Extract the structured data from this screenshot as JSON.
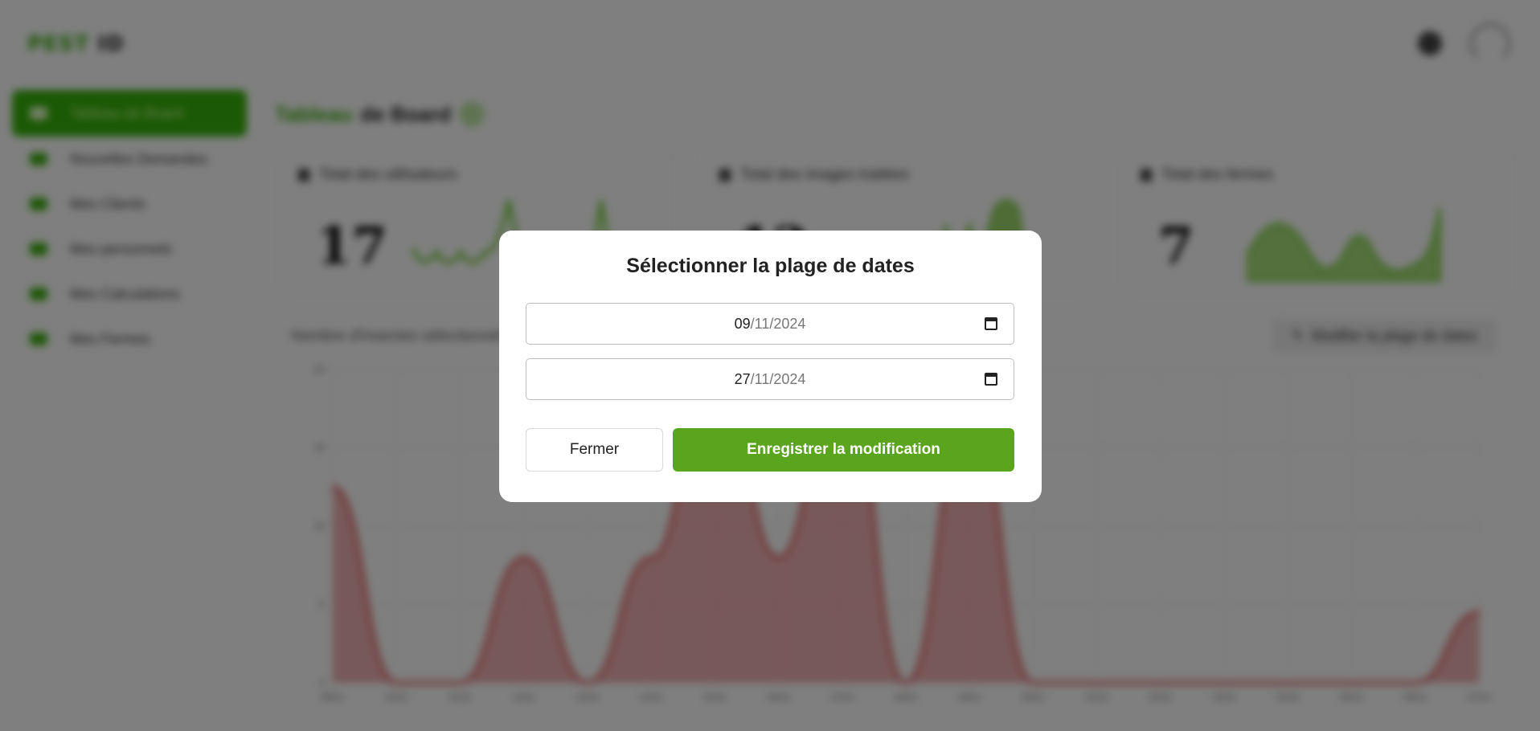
{
  "app": {
    "logo_part1": "PEST",
    "logo_part2": "ID"
  },
  "sidebar": {
    "items": [
      {
        "label": "Tableau de Board"
      },
      {
        "label": "Nouvelles Demandes"
      },
      {
        "label": "Mes Clients"
      },
      {
        "label": "Mes personnels"
      },
      {
        "label": "Mes Calculations"
      },
      {
        "label": "Mes Fermes"
      }
    ]
  },
  "header": {
    "title_part1": "Tableau",
    "title_part2": "de Board"
  },
  "stats": [
    {
      "label": "Total des utilisateurs",
      "value": "17"
    },
    {
      "label": "Total des images traitées",
      "value": "12"
    },
    {
      "label": "Total des fermes",
      "value": "7"
    }
  ],
  "chart_section": {
    "caption": "Nombre d'Insectes sélectionnés",
    "date_button_label": "Modifier la plage de dates"
  },
  "chart_data": {
    "type": "area",
    "x": [
      "09/11",
      "10/11",
      "11/11",
      "12/11",
      "13/11",
      "14/11",
      "15/11",
      "16/11",
      "17/11",
      "18/11",
      "19/11",
      "20/11",
      "21/11",
      "22/11",
      "23/11",
      "24/11",
      "25/11",
      "26/11",
      "27/11"
    ],
    "values": [
      12.5,
      0,
      0,
      8,
      0,
      8,
      21,
      8,
      21,
      0,
      18,
      0,
      0,
      0,
      0,
      0,
      0,
      0,
      4.5
    ],
    "ylim": [
      0,
      20
    ],
    "yticks": [
      "20",
      "15",
      "10",
      "5",
      "0"
    ],
    "color": "#e05555"
  },
  "modal": {
    "title": "Sélectionner la plage de dates",
    "start_day": "09",
    "start_rest": "11/2024",
    "end_day": "27",
    "end_rest": "11/2024",
    "close_label": "Fermer",
    "save_label": "Enregistrer la modification"
  },
  "colors": {
    "brand_green": "#3cae0e",
    "save_button": "#5aa41e",
    "chart_red": "#e05555"
  }
}
